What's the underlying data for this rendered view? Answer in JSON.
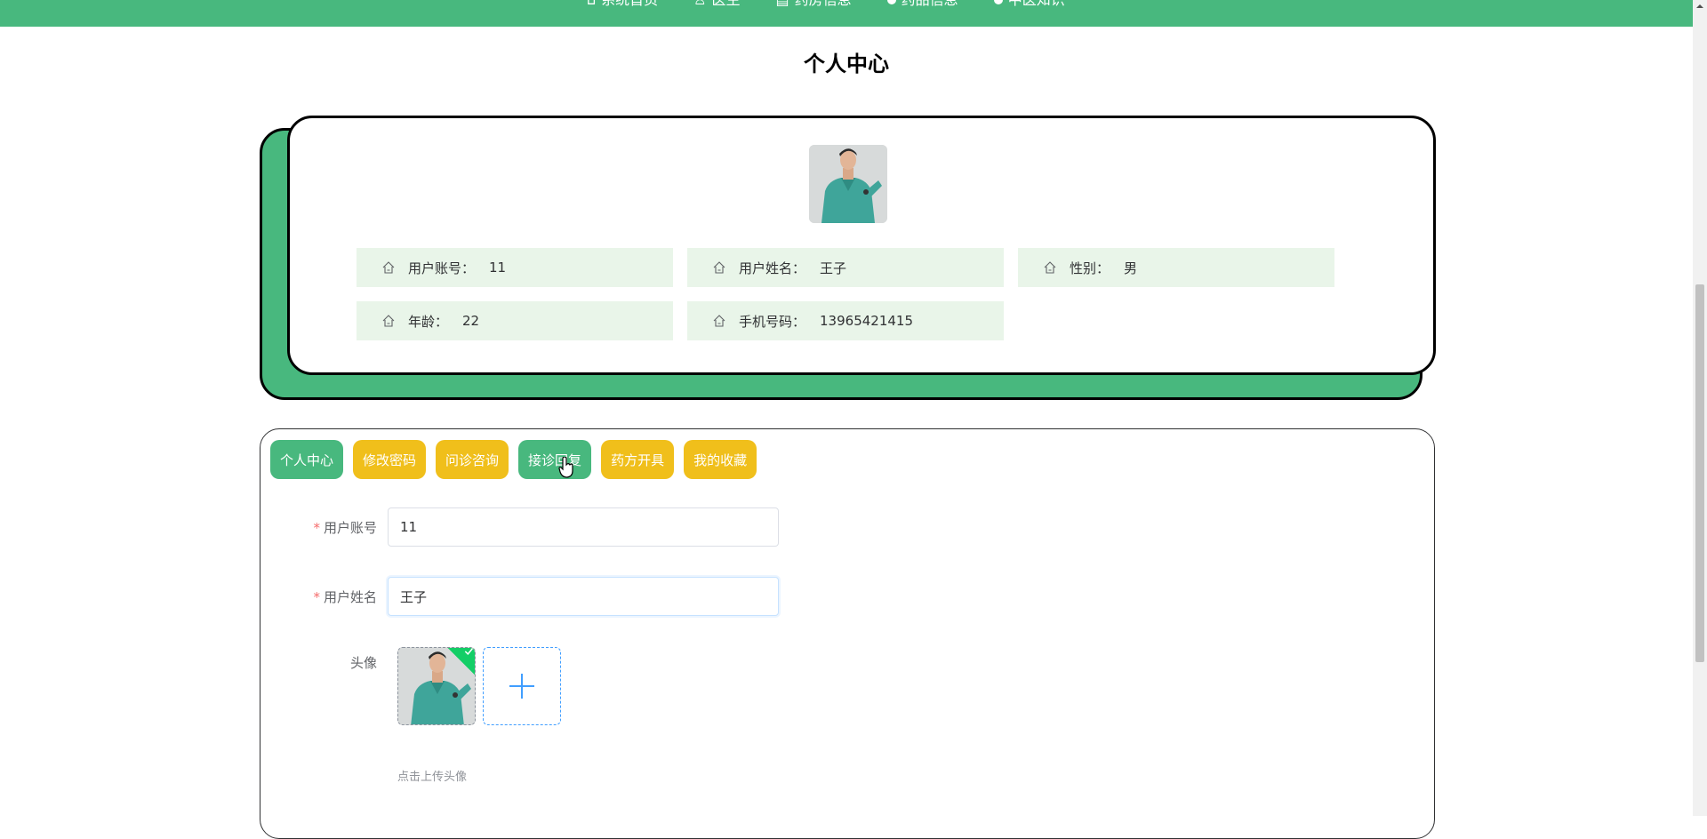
{
  "nav": {
    "items": [
      {
        "label": "系统首页",
        "icon": "home-icon"
      },
      {
        "label": "医生",
        "icon": "user-icon"
      },
      {
        "label": "药房信息",
        "icon": "building-icon"
      },
      {
        "label": "药品信息",
        "icon": "dot-icon"
      },
      {
        "label": "中医知识",
        "icon": "dot-icon"
      }
    ]
  },
  "page": {
    "title": "个人中心"
  },
  "profile": {
    "fields": [
      {
        "label": "用户账号：",
        "value": "11"
      },
      {
        "label": "用户姓名：",
        "value": "王子"
      },
      {
        "label": "性别：",
        "value": "男"
      },
      {
        "label": "年龄：",
        "value": "22"
      },
      {
        "label": "手机号码：",
        "value": "13965421415"
      }
    ]
  },
  "tabs": [
    {
      "label": "个人中心",
      "color": "#48b87e"
    },
    {
      "label": "修改密码",
      "color": "#f0bf1b"
    },
    {
      "label": "问诊咨询",
      "color": "#f0bf1b"
    },
    {
      "label": "接诊回复",
      "color": "#48b87e"
    },
    {
      "label": "药方开具",
      "color": "#f0bf1b"
    },
    {
      "label": "我的收藏",
      "color": "#f0bf1b"
    }
  ],
  "form": {
    "account": {
      "label": "用户账号",
      "value": "11",
      "required": "*"
    },
    "name": {
      "label": "用户姓名",
      "value": "王子",
      "required": "*"
    },
    "avatar": {
      "label": "头像",
      "tip": "点击上传头像"
    }
  },
  "colors": {
    "primary": "#48b87e",
    "accent": "#f0bf1b",
    "info_bg": "#e9f5e9"
  }
}
